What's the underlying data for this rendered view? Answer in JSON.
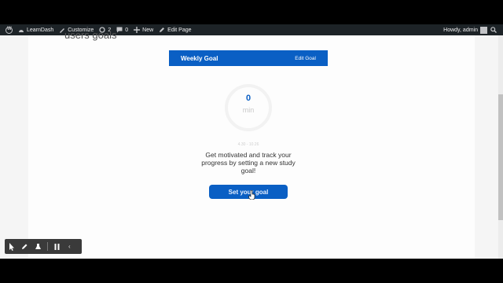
{
  "adminbar": {
    "site_name": "LearnDash",
    "customize": "Customize",
    "updates_count": "2",
    "comments_count": "0",
    "new_label": "New",
    "edit_page": "Edit Page",
    "greeting": "Howdy, admin"
  },
  "page": {
    "heading": "users goals"
  },
  "goal": {
    "title": "Weekly Goal",
    "edit_label": "Edit Goal",
    "value": "0",
    "unit": "min",
    "dates": "4.30 - 10.26",
    "message": "Get motivated and track your progress by setting a new study goal!",
    "button_label": "Set your goal"
  },
  "colors": {
    "accent": "#0a5fc4",
    "adminbar": "#1d2327"
  }
}
